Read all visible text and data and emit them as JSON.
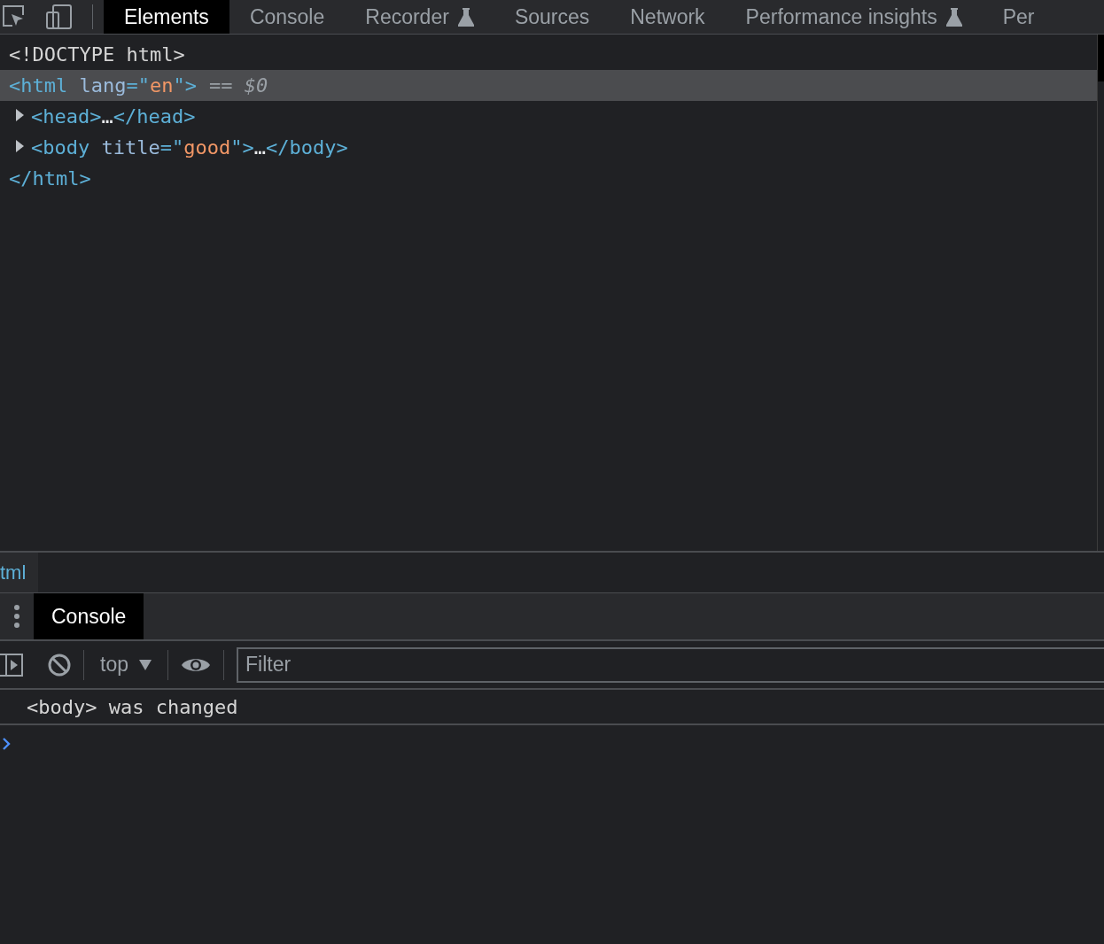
{
  "tabs": [
    {
      "label": "Elements",
      "selected": true,
      "experimental": false
    },
    {
      "label": "Console",
      "selected": false,
      "experimental": false
    },
    {
      "label": "Recorder",
      "selected": false,
      "experimental": true
    },
    {
      "label": "Sources",
      "selected": false,
      "experimental": false
    },
    {
      "label": "Network",
      "selected": false,
      "experimental": false
    },
    {
      "label": "Performance insights",
      "selected": false,
      "experimental": true
    },
    {
      "label": "Per",
      "selected": false,
      "experimental": false
    }
  ],
  "dom_tree": [
    {
      "segments": [
        {
          "kind": "doctype",
          "text": "<!DOCTYPE html>"
        }
      ],
      "selected": false
    },
    {
      "segments": [
        {
          "kind": "tag",
          "text": "<html "
        },
        {
          "kind": "attr",
          "text": "lang"
        },
        {
          "kind": "tag",
          "text": "=\""
        },
        {
          "kind": "value",
          "text": "en"
        },
        {
          "kind": "tag",
          "text": "\">"
        }
      ],
      "selected": true,
      "suffix": "== $0",
      "children": [
        {
          "segments": [
            {
              "kind": "tag",
              "text": "<head>"
            },
            {
              "kind": "ellipsis",
              "text": "…"
            },
            {
              "kind": "tag",
              "text": "</head>"
            }
          ],
          "selected": false,
          "collapsed": true
        },
        {
          "segments": [
            {
              "kind": "tag",
              "text": "<body "
            },
            {
              "kind": "attr",
              "text": "title"
            },
            {
              "kind": "tag",
              "text": "=\""
            },
            {
              "kind": "value",
              "text": "good"
            },
            {
              "kind": "tag",
              "text": "\">"
            },
            {
              "kind": "ellipsis",
              "text": "…"
            },
            {
              "kind": "tag",
              "text": "</body>"
            }
          ],
          "selected": false,
          "collapsed": true
        }
      ],
      "closing": [
        {
          "kind": "tag",
          "text": "</html>"
        }
      ]
    }
  ],
  "breadcrumb": [
    "tml"
  ],
  "drawer": {
    "tabs": [
      {
        "label": "Console",
        "selected": true
      }
    ],
    "context": "top",
    "filter": {
      "placeholder": "Filter"
    },
    "messages": [
      "<body> was changed"
    ]
  }
}
